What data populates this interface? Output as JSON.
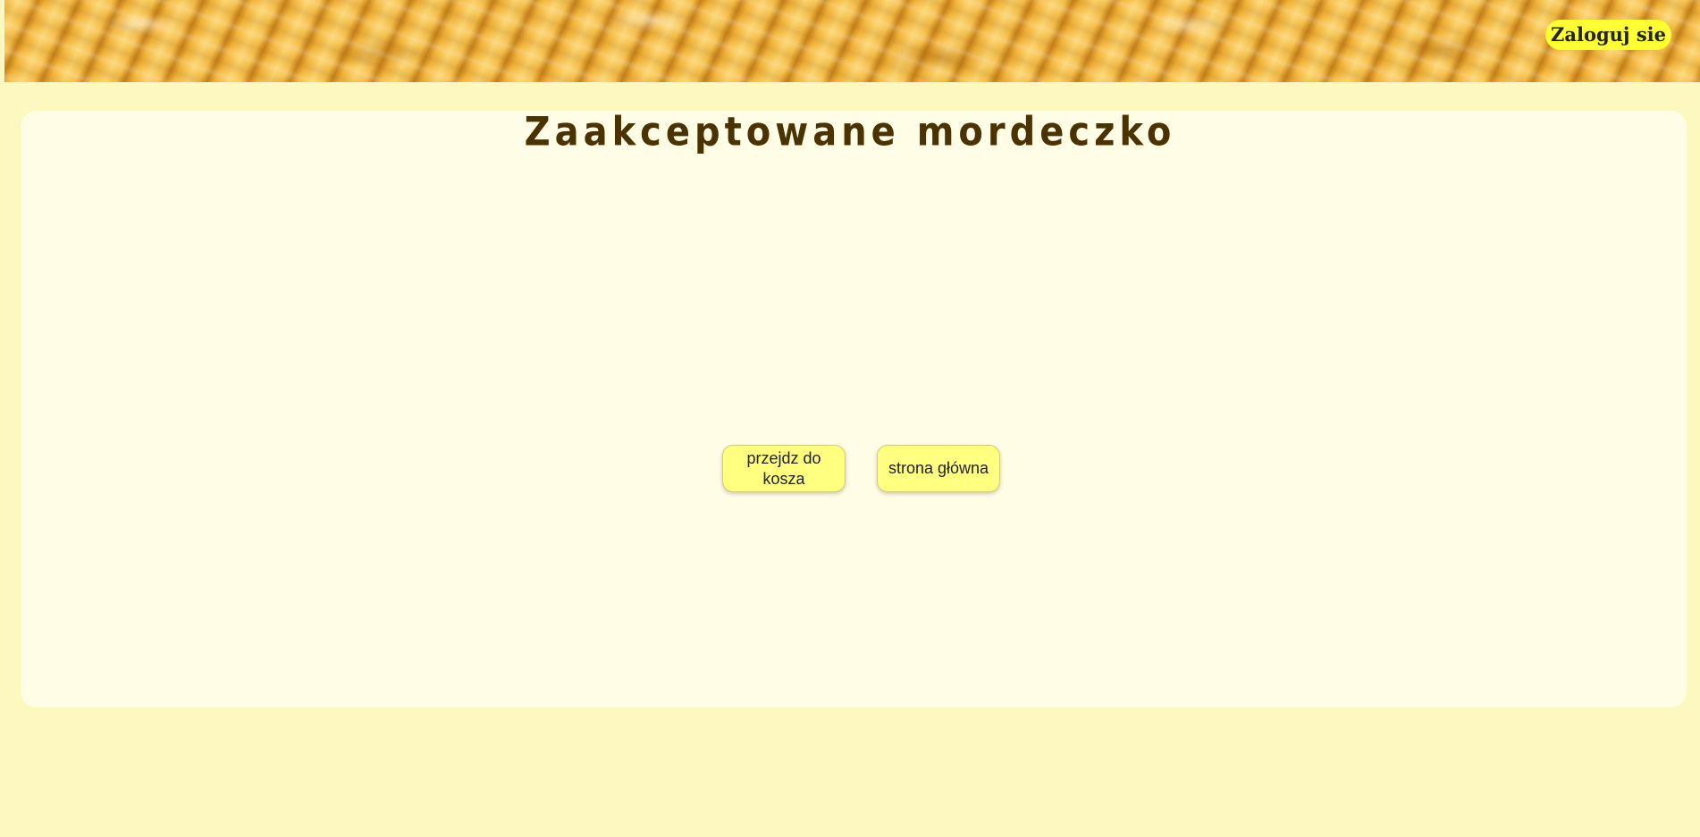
{
  "header": {
    "login_label": "Zaloguj sie"
  },
  "main": {
    "title": "Zaakceptowane mordeczko",
    "buttons": {
      "go_to_cart": "przejdz do kosza",
      "home_page": "strona główna"
    }
  },
  "colors": {
    "page_background": "#fdf8c0",
    "panel_background": "#fffde6",
    "button_background": "#ffff80",
    "login_background": "#ffff33",
    "title_color": "#4a3300"
  }
}
